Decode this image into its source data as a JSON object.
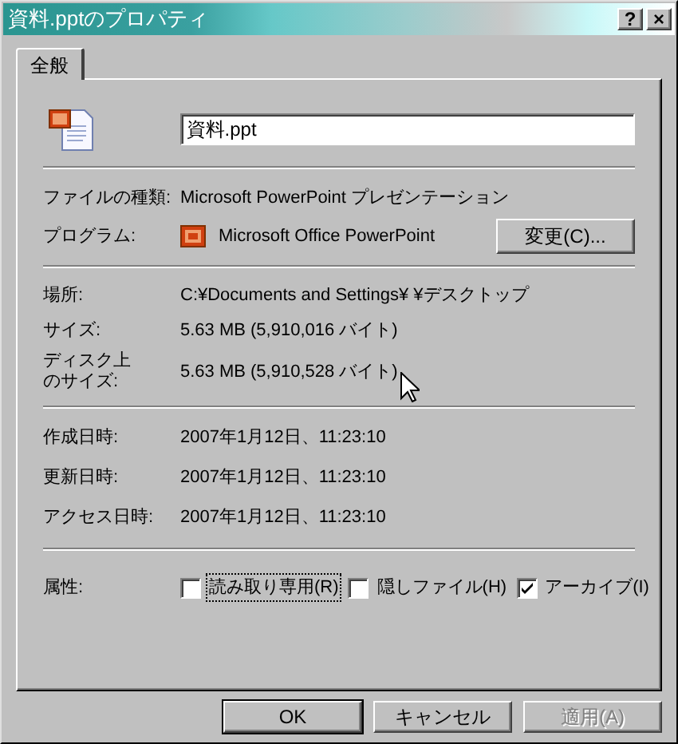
{
  "window": {
    "title": "資料.pptのプロパティ",
    "title_buttons": [
      "?",
      "×"
    ]
  },
  "tabs": [
    {
      "label": "全般",
      "selected": true
    }
  ],
  "file_name": {
    "value": "資料.ppt"
  },
  "file_type": {
    "label": "ファイルの種類:",
    "value": "Microsoft PowerPoint プレゼンテーション"
  },
  "program": {
    "label": "プログラム:",
    "value": "Microsoft Office PowerPoint",
    "button": "変更(C)..."
  },
  "location_info": [
    {
      "label": "場所:",
      "value": "C:¥Documents and Settings¥ ¥デスクトップ"
    },
    {
      "label": "サイズ:",
      "value": "5.63 MB (5,910,016 バイト)"
    },
    {
      "label": "ディスク上のサイズ:",
      "value": "5.63 MB (5,910,528 バイト)"
    }
  ],
  "dates": [
    {
      "label": "作成日時:",
      "value": "2007年1月12日、11:23:10"
    },
    {
      "label": "更新日時:",
      "value": "2007年1月12日、11:23:10"
    },
    {
      "label": "アクセス日時:",
      "value": "2007年1月12日、11:23:10"
    }
  ],
  "attributes": {
    "label": "属性:",
    "items": [
      {
        "label": "読み取り専用(R)",
        "checked": false,
        "focused": true
      },
      {
        "label": "隠しファイル(H)",
        "checked": false,
        "focused": false
      },
      {
        "label": "アーカイブ(I)",
        "checked": true,
        "focused": false
      }
    ]
  },
  "buttons": [
    {
      "label": "OK",
      "disabled": false,
      "default": true
    },
    {
      "label": "キャンセル",
      "disabled": false,
      "default": false
    },
    {
      "label": "適用(A)",
      "disabled": true,
      "default": false
    }
  ]
}
